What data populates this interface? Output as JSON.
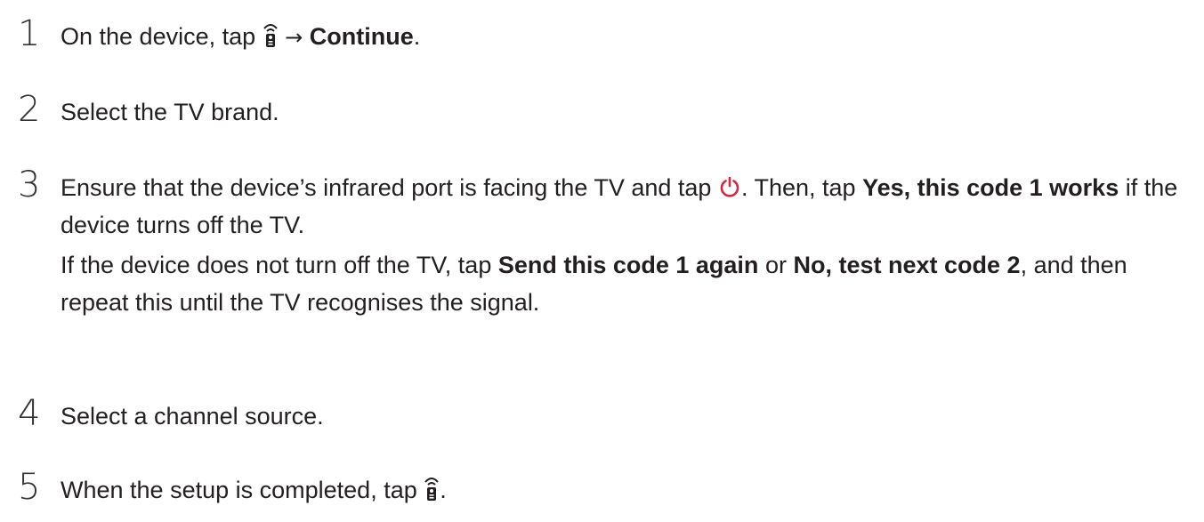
{
  "steps": [
    {
      "number": "1",
      "text_1": "On the device, tap",
      "icon": "remote-wifi-icon",
      "arrow": "→",
      "bold_1": "Continue",
      "text_2": "."
    },
    {
      "number": "2",
      "text_1": "Select the TV brand."
    },
    {
      "number": "3",
      "text_1": "Ensure that the device’s infrared port is facing the TV and tap",
      "icon": "power-icon",
      "text_2": ". Then, tap",
      "bold_1": "Yes, this code 1 works",
      "text_3": "if the device turns off the TV.",
      "para2_text_1": "If the device does not turn off the TV, tap",
      "para2_bold_1": "Send this code 1 again",
      "para2_text_2": "or",
      "para2_bold_2": "No, test next code 2",
      "para2_text_3": ", and then repeat this until the TV recognises the signal."
    },
    {
      "number": "4",
      "text_1": "Select a channel source."
    },
    {
      "number": "5",
      "text_1": "When the setup is completed, tap",
      "icon": "remote-wifi-icon",
      "text_2": "."
    }
  ],
  "colors": {
    "text": "#231f20",
    "power_icon": "#d7263d"
  }
}
